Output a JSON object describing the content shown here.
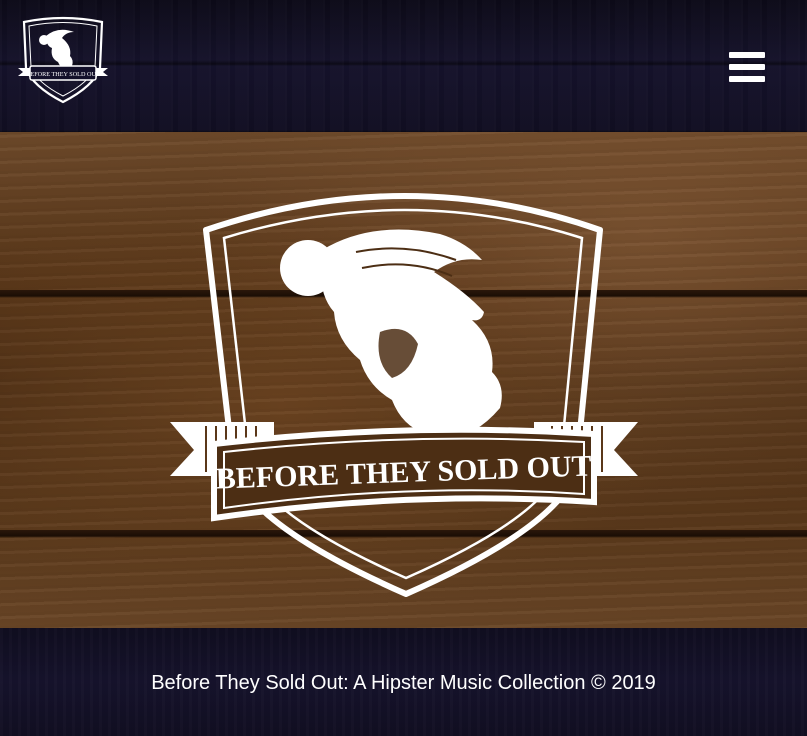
{
  "header": {
    "logo_icon": "before-they-sold-out-logo",
    "logo_text": "BEFORE THEY SOLD OUT",
    "menu_icon": "hamburger-menu-icon"
  },
  "hero": {
    "emblem_icon": "bearded-man-crest-emblem",
    "emblem_text": "BEFORE THEY SOLD OUT"
  },
  "footer": {
    "copyright": "Before They Sold Out: A Hipster Music Collection © 2019"
  },
  "colors": {
    "header_bg": "#13102a",
    "footer_bg": "#13102a",
    "wood": "#5a3719",
    "emblem": "#ffffff"
  }
}
